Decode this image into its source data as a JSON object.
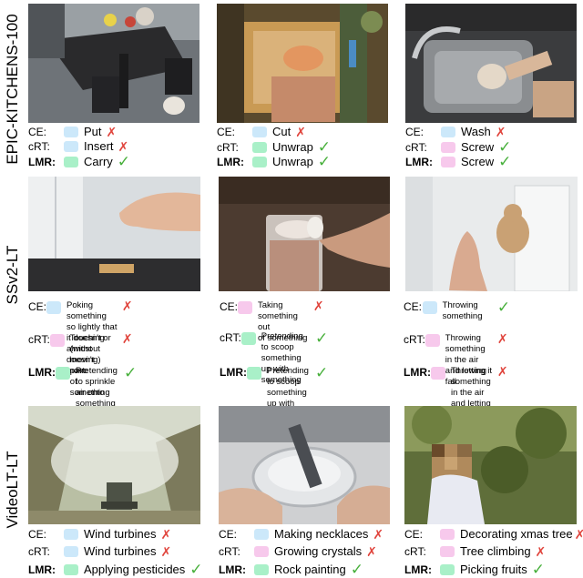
{
  "sections": [
    {
      "label": "EPIC-KITCHENS-100",
      "panels": [
        {
          "image": "overhead kitchen view with table, chairs and bowls",
          "rows": [
            {
              "key": "CE:",
              "color": "blue",
              "text": "Put",
              "correct": false
            },
            {
              "key": "cRT:",
              "color": "blue",
              "text": "Insert",
              "correct": false
            },
            {
              "key": "LMR:",
              "color": "green",
              "text": "Carry",
              "correct": true
            }
          ]
        },
        {
          "image": "hands cutting food on a cutting board",
          "rows": [
            {
              "key": "CE:",
              "color": "blue",
              "text": "Cut",
              "correct": false
            },
            {
              "key": "cRT:",
              "color": "green",
              "text": "Unwrap",
              "correct": true
            },
            {
              "key": "LMR:",
              "color": "green",
              "text": "Unwrap",
              "correct": true
            }
          ]
        },
        {
          "image": "hands at a metal kitchen sink with faucet",
          "rows": [
            {
              "key": "CE:",
              "color": "blue",
              "text": "Wash",
              "correct": false
            },
            {
              "key": "cRT:",
              "color": "pink",
              "text": "Screw",
              "correct": true
            },
            {
              "key": "LMR:",
              "color": "pink",
              "text": "Screw",
              "correct": true
            }
          ]
        }
      ]
    },
    {
      "label": "SSv2-LT",
      "panels": [
        {
          "image": "hand above a small object on a table",
          "rows": [
            {
              "key": "CE:",
              "color": "blue",
              "text": "Poking something so lightly that\nit doesn't or almost doesn't move",
              "correct": false
            },
            {
              "key": "cRT:",
              "color": "pink",
              "text": "Touching (without moving) part\nof something",
              "correct": false
            },
            {
              "key": "LMR:",
              "color": "green",
              "text": "Pretending to sprinkle air onto\nsomething",
              "correct": true
            }
          ]
        },
        {
          "image": "glass of powder with a spoon",
          "rows": [
            {
              "key": "CE:",
              "color": "pink",
              "text": "Taking something out\nof something",
              "correct": false
            },
            {
              "key": "cRT:",
              "color": "green",
              "text": "Pretending to scoop\nsomething up with\nsomething",
              "correct": true
            },
            {
              "key": "LMR:",
              "color": "green",
              "text": "Pretending to scoop\nsomething up with\nsomething",
              "correct": true
            }
          ]
        },
        {
          "image": "hand throwing a teddy bear in a room",
          "rows": [
            {
              "key": "CE:",
              "color": "blue",
              "text": "Throwing something",
              "correct": true
            },
            {
              "key": "cRT:",
              "color": "pink",
              "text": "Throwing something in the air\nand letting it fall",
              "correct": false
            },
            {
              "key": "LMR:",
              "color": "pink",
              "text": "Throwing something in the air\nand letting it fall",
              "correct": false
            }
          ]
        }
      ]
    },
    {
      "label": "VideoLT-LT",
      "panels": [
        {
          "image": "tractor spraying in an orchard",
          "rows": [
            {
              "key": "CE:",
              "color": "blue",
              "text": "Wind turbines",
              "correct": false
            },
            {
              "key": "cRT:",
              "color": "blue",
              "text": "Wind turbines",
              "correct": false
            },
            {
              "key": "LMR:",
              "color": "green",
              "text": "Applying pesticides",
              "correct": true
            }
          ]
        },
        {
          "image": "hand holding a glass dish with crystals",
          "rows": [
            {
              "key": "CE:",
              "color": "blue",
              "text": "Making necklaces",
              "correct": false
            },
            {
              "key": "cRT:",
              "color": "pink",
              "text": "Growing crystals",
              "correct": false
            },
            {
              "key": "LMR:",
              "color": "green",
              "text": "Rock painting",
              "correct": true
            }
          ]
        },
        {
          "image": "person picking fruit from a tree, face blurred",
          "rows": [
            {
              "key": "CE:",
              "color": "pink",
              "text": "Decorating xmas tree",
              "correct": false
            },
            {
              "key": "cRT:",
              "color": "pink",
              "text": "Tree climbing",
              "correct": false
            },
            {
              "key": "LMR:",
              "color": "green",
              "text": "Picking fruits",
              "correct": true
            }
          ]
        }
      ]
    }
  ],
  "marks": {
    "correct": "✓",
    "wrong": "✗"
  },
  "colors": {
    "blue": "#cce8fa",
    "pink": "#f7c9ec",
    "green": "#a9f0c8",
    "wrong_mark": "#e0433b",
    "right_mark": "#48b03c"
  }
}
